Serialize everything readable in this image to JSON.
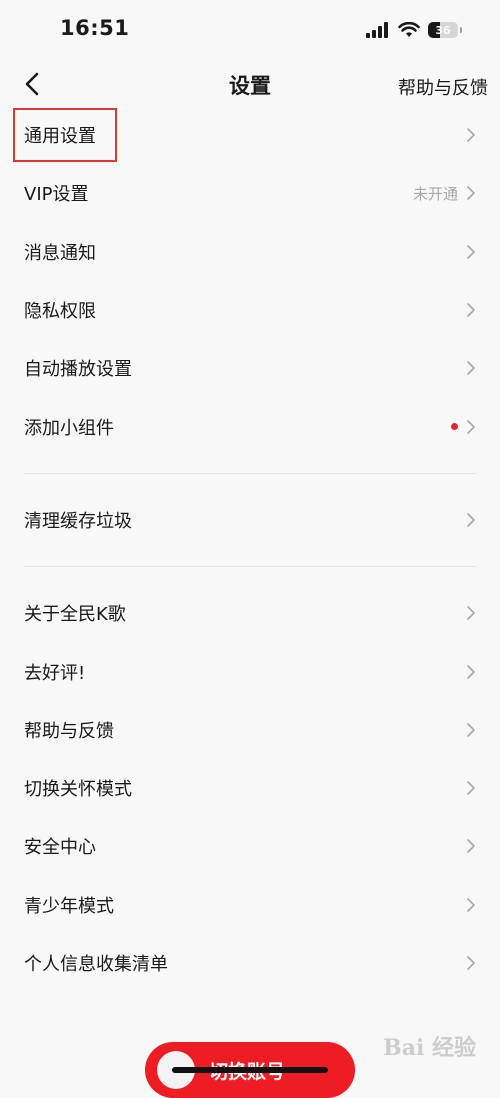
{
  "status_bar": {
    "time": "16:51",
    "battery_level": "36",
    "icons": [
      "signal-icon",
      "wifi-icon",
      "battery-icon"
    ]
  },
  "nav": {
    "title": "设置",
    "help": "帮助与反馈",
    "back_icon": "chevron-left-icon"
  },
  "groups": [
    [
      {
        "label": "通用设置"
      },
      {
        "label": "VIP设置",
        "value": "未开通"
      },
      {
        "label": "消息通知"
      },
      {
        "label": "隐私权限"
      },
      {
        "label": "自动播放设置"
      },
      {
        "label": "添加小组件",
        "badge": "red-dot"
      }
    ],
    [
      {
        "label": "清理缓存垃圾"
      }
    ],
    [
      {
        "label": "关于全民K歌"
      },
      {
        "label": "去好评!"
      },
      {
        "label": "帮助与反馈"
      },
      {
        "label": "切换关怀模式"
      },
      {
        "label": "安全中心"
      },
      {
        "label": "青少年模式"
      },
      {
        "label": "个人信息收集清单"
      }
    ]
  ],
  "switch_account": {
    "label": "切换账号"
  },
  "watermark": "Bai 经验",
  "colors": {
    "accent": "#ee1d23",
    "highlight_box": "#d63a35",
    "badge": "#e5232e",
    "background": "#f8f8f8"
  }
}
